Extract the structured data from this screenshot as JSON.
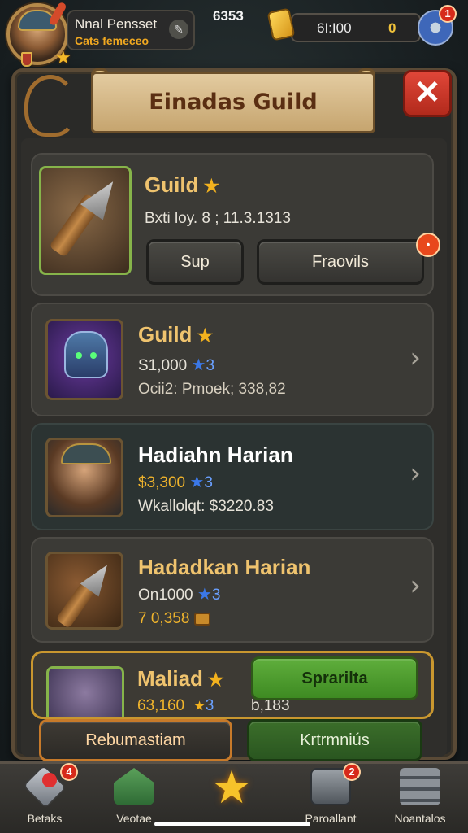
{
  "player": {
    "name": "Nnal Pensset",
    "subtitle": "Cats femeceo",
    "top_number": "6353"
  },
  "currency": {
    "amount": "6I:I00",
    "extra": "0"
  },
  "badges": {
    "settings": "1",
    "nav_first": "4",
    "nav_fourth": "2"
  },
  "panel": {
    "title": "Einadas Guild",
    "close_label": "✕"
  },
  "cards": [
    {
      "title": "Guild",
      "line1": "Bxti loy. 8 ; 11.3.1313",
      "button1": "Sup",
      "button2": "Fraovils"
    },
    {
      "title": "Guild",
      "line1_value": "S1,000",
      "line1_star_value": "3",
      "line2": "Ocii2: Pmoek; 338,82"
    },
    {
      "title": "Hadiahn Harian",
      "line1_value": "$3,300",
      "line1_star_value": "3",
      "line2": "Wkallolqt: $3220.83"
    },
    {
      "title": "Hadadkan Harian",
      "line1_value": "On1000",
      "line1_star_value": "3",
      "line2_value": "7 0,358"
    },
    {
      "title": "Maliad",
      "line1_value": "63,160",
      "line1_star_value": "3",
      "line1_extra": "b,183",
      "button": "Sprarilta"
    }
  ],
  "action_buttons": {
    "left": "Rebumastiam",
    "right": "Krtrmniús"
  },
  "nav": [
    {
      "label": "Betaks"
    },
    {
      "label": "Veotae"
    },
    {
      "label": ""
    },
    {
      "label": "Paroallant"
    },
    {
      "label": "Noantalos"
    }
  ],
  "colors": {
    "accent_gold": "#f0b42c",
    "title_gold": "#efc36e",
    "close_red": "#d23a2a",
    "green_button": "#5fae3c"
  }
}
